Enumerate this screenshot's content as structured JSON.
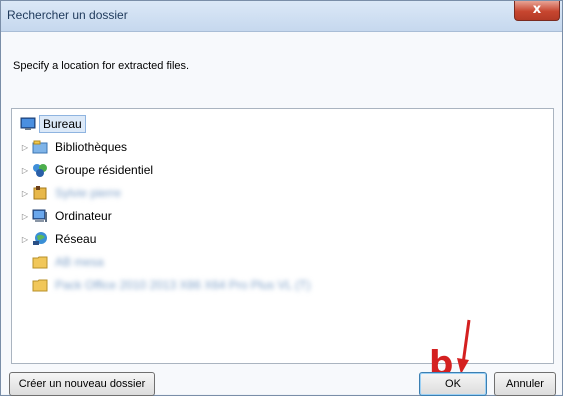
{
  "window": {
    "title": "Rechercher un dossier",
    "close_glyph": "x"
  },
  "dialog": {
    "instruction": "Specify a location for extracted files."
  },
  "tree": {
    "items": [
      {
        "label": "Bureau",
        "icon": "desktop-icon",
        "expander": ""
      },
      {
        "label": "Bibliothèques",
        "icon": "library-icon",
        "expander": "▷"
      },
      {
        "label": "Groupe résidentiel",
        "icon": "homegroup-icon",
        "expander": "▷"
      },
      {
        "label": "Sylvie pierre",
        "icon": "user-folder-icon",
        "expander": "▷"
      },
      {
        "label": "Ordinateur",
        "icon": "computer-icon",
        "expander": "▷"
      },
      {
        "label": "Réseau",
        "icon": "network-icon",
        "expander": "▷"
      },
      {
        "label": "AB mesa",
        "icon": "folder-icon",
        "expander": ""
      },
      {
        "label": "Pack Office 2010 2013 X86 X64 Pro Plus VL (T)",
        "icon": "folder-icon",
        "expander": ""
      }
    ]
  },
  "buttons": {
    "new_folder": "Créer un nouveau dossier",
    "ok": "OK",
    "cancel": "Annuler"
  },
  "annotation": {
    "letter": "b"
  },
  "colors": {
    "selection": "#dce9f8",
    "annotation": "#d42020",
    "close": "#c7462f"
  }
}
